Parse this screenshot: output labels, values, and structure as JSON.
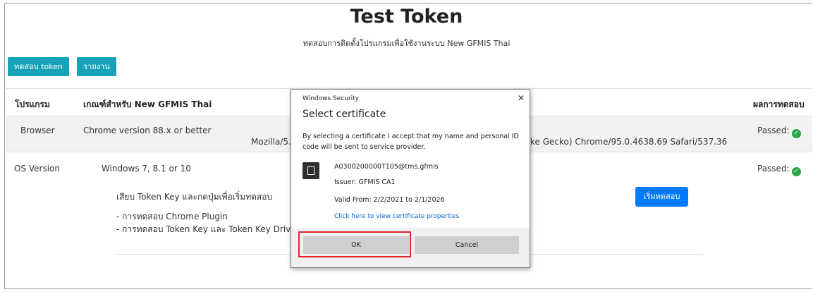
{
  "page": {
    "title": "Test Token",
    "subtitle": "ทดสอบการติดตั้งโปรแกรมเพื่อใช้งานระบบ New GFMIS Thai"
  },
  "toolbar": {
    "test_token_label": "ทดสอบ token",
    "report_label": "รายงาน"
  },
  "table": {
    "headers": {
      "program": "โปรแกรม",
      "criteria": "เกณฑ์สำหรับ New GFMIS Thai",
      "result": "ผลการทดสอบ"
    },
    "rows": [
      {
        "program": "Browser",
        "criteria": "Chrome version 88.x or better",
        "detail_left": "Mozilla/5.",
        "detail_right": "ke Gecko) Chrome/95.0.4638.69 Safari/537.36",
        "result": "Passed:"
      },
      {
        "program": "OS Version",
        "criteria": "Windows 7, 8.1 or 10",
        "instruction": "เสียบ Token Key และกดปุ่มเพื่อเริ่มทดสอบ",
        "list": [
          "- การทดสอบ Chrome Plugin",
          "- การทดสอบ Token Key และ Token Key Drivers"
        ],
        "start_button": "เริ่มทดสอบ",
        "result": "Passed:"
      }
    ]
  },
  "dialog": {
    "caption": "Windows Security",
    "close": "✕",
    "heading": "Select certificate",
    "description": "By selecting a certificate I accept that my name and personal ID code will be sent to service provider.",
    "certificate": {
      "name": "A0300200000T105@tms.gfmis",
      "issuer": "Issuer: GFMIS CA1",
      "valid": "Valid From: 2/2/2021 to 2/1/2026",
      "properties_link": "Click here to view certificate properties"
    },
    "ok_label": "OK",
    "cancel_label": "Cancel"
  },
  "colors": {
    "teal": "#17a2b8",
    "primary_blue": "#007bff",
    "success_green": "#28a745",
    "highlight_red": "#e0262b"
  },
  "icons": {
    "check": "check-circle-icon",
    "certificate": "certificate-icon"
  }
}
